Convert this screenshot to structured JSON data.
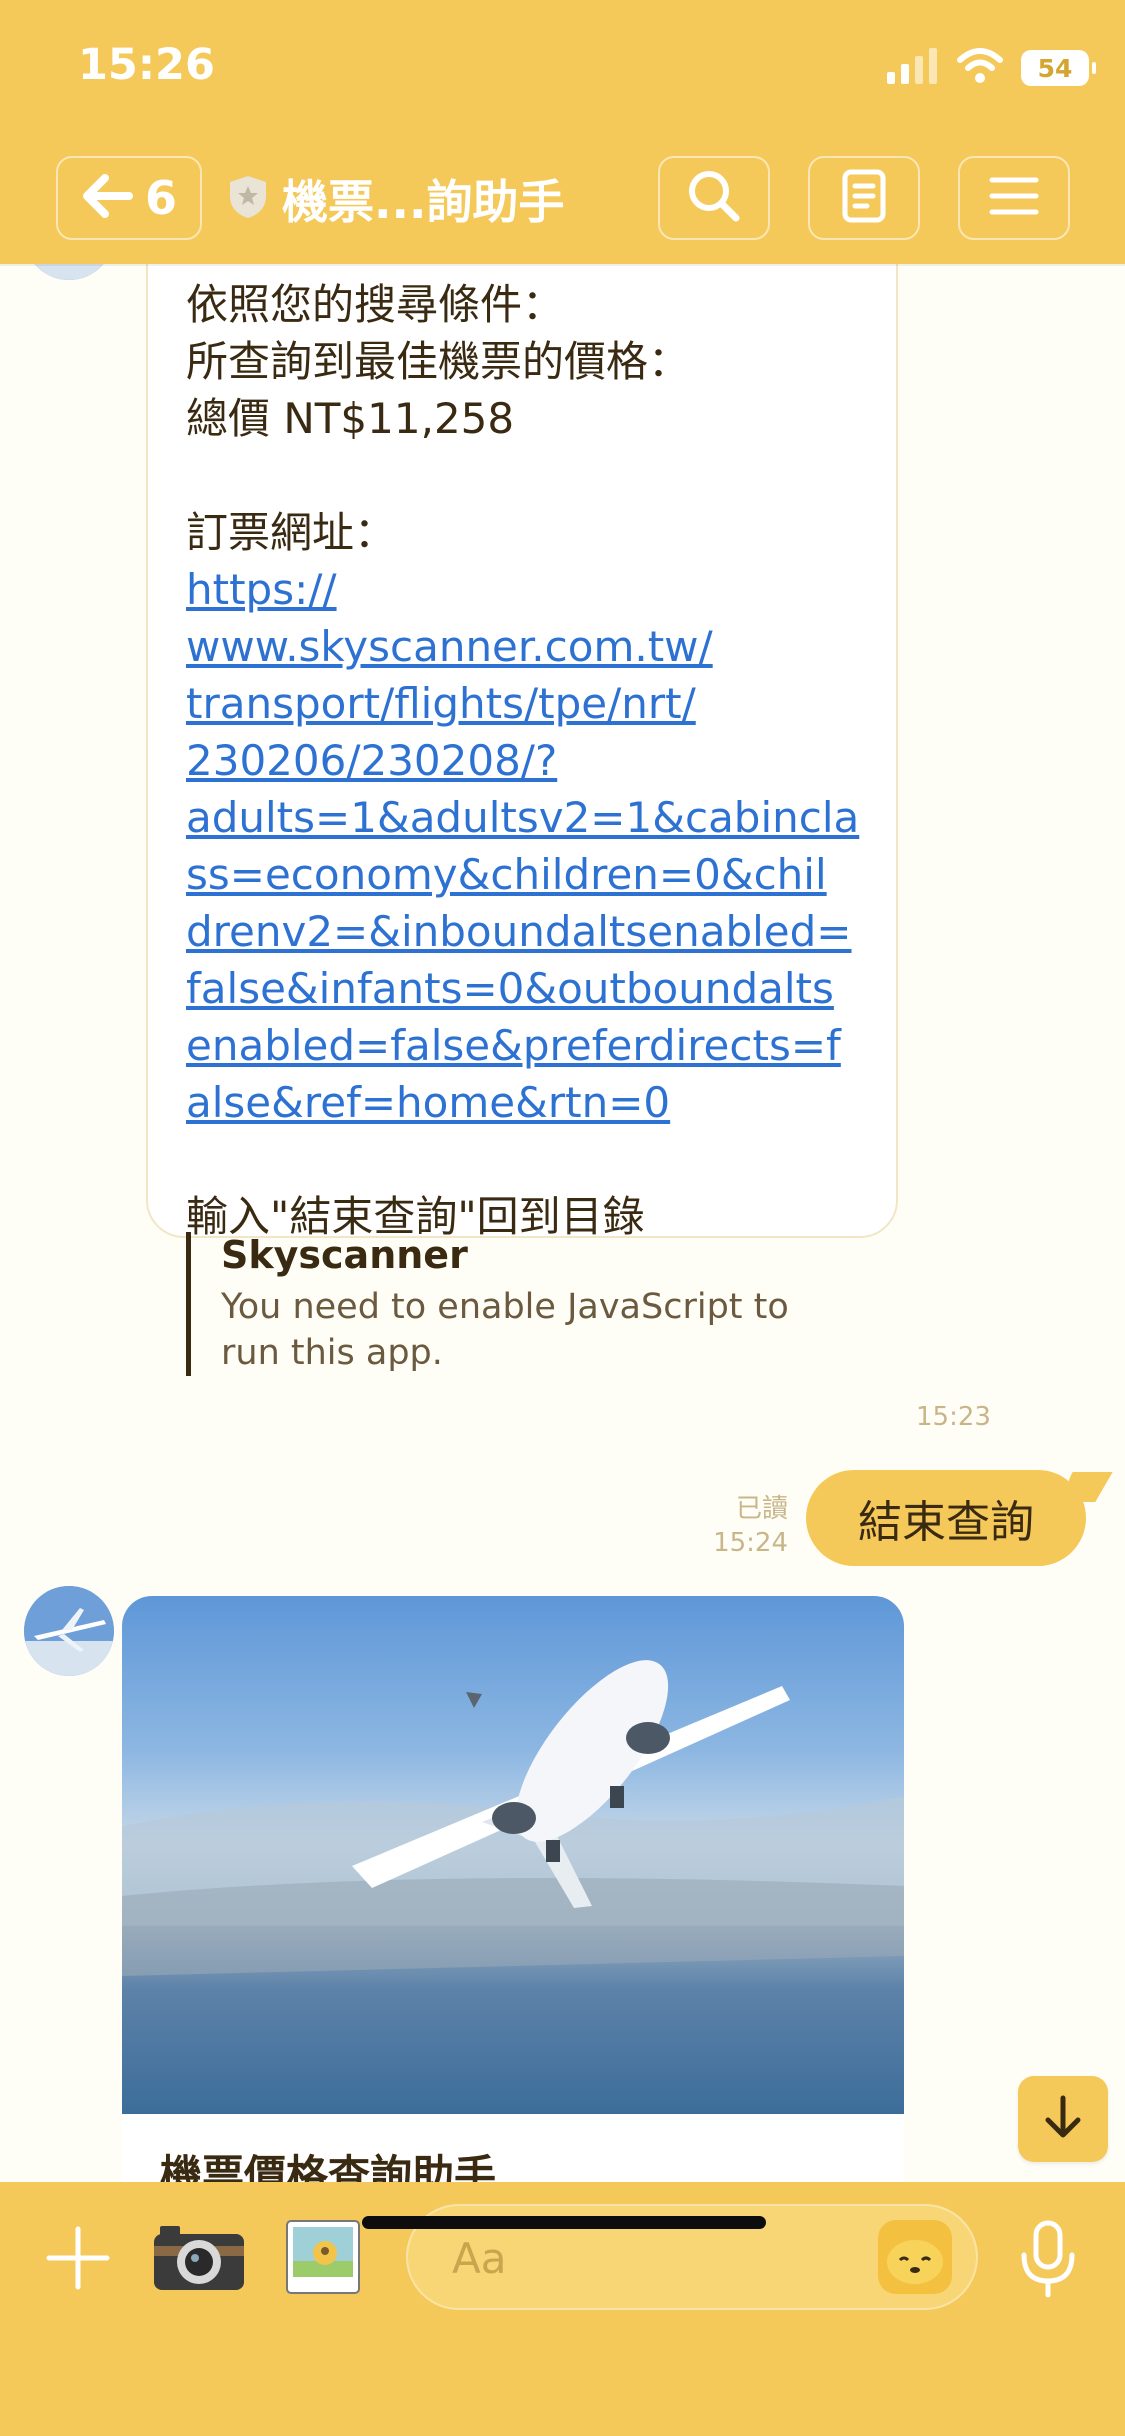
{
  "status_bar": {
    "time": "15:26",
    "battery": "54"
  },
  "header": {
    "back_count": "6",
    "title": "機票...詢助手"
  },
  "messages": {
    "bot_reply": {
      "lines": [
        "依照您的搜尋條件：",
        "所查詢到最佳機票的價格：",
        "總價 NT$11,258",
        "",
        "訂票網址："
      ],
      "link_lines": [
        "https://",
        "www.skyscanner.com.tw/",
        "transport/flights/tpe/nrt/",
        "230206/230208/?",
        "adults=1&adultsv2=1&cabincla",
        "ss=economy&children=0&chil",
        "drenv2=&inboundaltsenabled=",
        "false&infants=0&outboundalts",
        "enabled=false&preferdirects=f",
        "alse&ref=home&rtn=0"
      ],
      "footer_line": "輸入\"結束查詢\"回到目錄",
      "preview": {
        "title": "Skyscanner",
        "description": "You need to enable JavaScript to run this app."
      },
      "time": "15:23"
    },
    "user_reply": {
      "text": "結束查詢",
      "read_label": "已讀",
      "time": "15:24"
    },
    "card": {
      "title": "機票價格查詢助手"
    }
  },
  "input_bar": {
    "placeholder": "Aa"
  },
  "icons": {
    "back": "arrow-left-icon",
    "shield": "shield-icon",
    "search": "search-icon",
    "notes": "notes-icon",
    "menu": "hamburger-menu-icon",
    "scroll_down": "arrow-down-icon",
    "plus": "plus-icon",
    "camera": "camera-icon",
    "image": "image-icon",
    "sticker": "sticker-icon",
    "mic": "microphone-icon"
  },
  "colors": {
    "header_bg": "#f4c95a",
    "chat_bg": "#fffef6",
    "link": "#2d72d2",
    "user_bubble": "#f4c95a"
  }
}
